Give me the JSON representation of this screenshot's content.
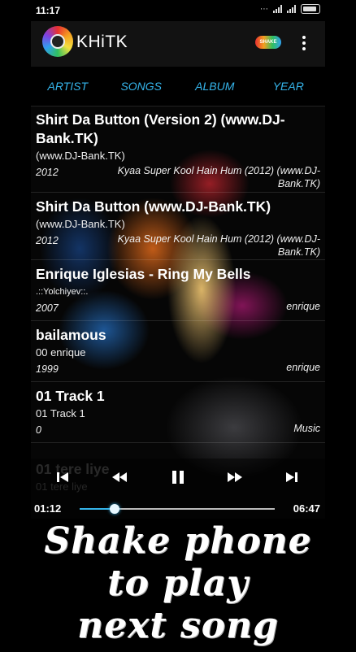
{
  "status_bar": {
    "time": "11:17"
  },
  "app_bar": {
    "title": "KHiTK",
    "shake_badge": "SHAKE"
  },
  "tabs": [
    {
      "label": "ARTIST"
    },
    {
      "label": "SONGS"
    },
    {
      "label": "ALBUM"
    },
    {
      "label": "YEAR"
    }
  ],
  "songs": [
    {
      "title": "Shirt Da Button (Version 2) (www.DJ-Bank.TK)",
      "artist": "(www.DJ-Bank.TK)",
      "year": "2012",
      "album": "Kyaa Super Kool Hain Hum (2012) (www.DJ-Bank.TK)"
    },
    {
      "title": "Shirt Da Button (www.DJ-Bank.TK)",
      "artist": "(www.DJ-Bank.TK)",
      "year": "2012",
      "album": "Kyaa Super Kool Hain Hum (2012) (www.DJ-Bank.TK)"
    },
    {
      "title": "Enrique Iglesias - Ring My Bells",
      "artist": ".::Yolchiyev::.",
      "year": "2007",
      "album": "enrique"
    },
    {
      "title": "bailamous",
      "artist": "00 enrique",
      "year": "1999",
      "album": "enrique"
    },
    {
      "title": "01 Track 1",
      "artist": "01 Track 1",
      "year": "0",
      "album": "Music"
    },
    {
      "title": "01 tere liye",
      "artist": "01 tere liye"
    }
  ],
  "player": {
    "current_time": "01:12",
    "total_time": "06:47",
    "progress": 0.18
  },
  "promo": {
    "line1": "Shake phone",
    "line2": "to play",
    "line3": "next song"
  }
}
